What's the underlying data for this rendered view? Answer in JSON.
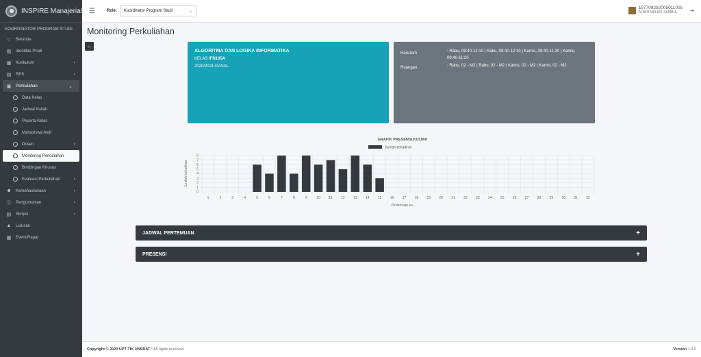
{
  "app": {
    "title": "INSPIRE Manajerial"
  },
  "sidebar": {
    "section": "KOORDINATOR PROGRAM STUDI",
    "items": [
      {
        "label": "Beranda",
        "icon": "home-icon"
      },
      {
        "label": "Identitas Prodi",
        "icon": "university-icon"
      },
      {
        "label": "Kurikulum",
        "icon": "table-icon"
      },
      {
        "label": "RPS",
        "icon": "book-icon"
      },
      {
        "label": "Perkuliahan",
        "icon": "briefcase-icon"
      }
    ],
    "sub_items": [
      {
        "label": "Data Kelas"
      },
      {
        "label": "Jadwal Kuliah"
      },
      {
        "label": "Peserta Kelas"
      },
      {
        "label": "Mahasiswa Aktif"
      },
      {
        "label": "Dosen"
      },
      {
        "label": "Monitoring Perkuliahan"
      },
      {
        "label": "Bimbingan Khusus"
      },
      {
        "label": "Evaluasi Perkuliahan"
      }
    ],
    "items_after": [
      {
        "label": "Kemahasiswaan",
        "icon": "users-icon"
      },
      {
        "label": "Pengumuman",
        "icon": "info-icon"
      },
      {
        "label": "Skripsi",
        "icon": "book-icon"
      },
      {
        "label": "Lulusan",
        "icon": "graduation-cap-icon"
      },
      {
        "label": "Event/Rapat",
        "icon": "calendar-icon"
      }
    ]
  },
  "topbar": {
    "role_label": "Role:",
    "role_value": "Koordinator Program Studi",
    "user_id": "197709292005011005",
    "user_name": "ALWIN MELKIE SAMBUL"
  },
  "page": {
    "title": "Monitoring Perkuliahan"
  },
  "course": {
    "name": "ALGORITMA DAN LOGIKA INFORMATIKA",
    "class_prefix": "KELAS ",
    "class_code": "IFN105A",
    "semester": "2020/2021 GASAL"
  },
  "schedule": {
    "day_time_label": "Hari/Jam",
    "day_time_value": ": Rabu, 09:40-12:10 | Rabu, 09:40-12:10 | Kamis, 09:40-11:20 | Kamis, 09:40-11:20",
    "room_label": "Ruangan",
    "room_value": ": Rabu, 02 - M2 | Rabu, 02 - M2 | Kamis, 02 - M2 | Kamis, 02 - M2"
  },
  "chart_data": {
    "type": "bar",
    "title": "GRAFIK PRESENSI KULIAH",
    "xlabel": "Pertemuan ke-",
    "ylabel": "Jumlah kehadiran",
    "legend": "Jumlah kehadiran",
    "ylim": [
      0,
      8
    ],
    "categories": [
      "1",
      "2",
      "3",
      "4",
      "5",
      "6",
      "7",
      "8",
      "9",
      "10",
      "11",
      "12",
      "13",
      "14",
      "15",
      "16",
      "17",
      "18",
      "19",
      "20",
      "21",
      "22",
      "23",
      "24",
      "25",
      "26",
      "27",
      "28",
      "29",
      "30",
      "31",
      "32"
    ],
    "values": [
      0,
      0,
      0,
      0,
      6,
      4,
      8,
      4,
      8,
      6,
      7,
      5,
      8,
      6,
      3,
      0,
      0,
      0,
      0,
      0,
      0,
      0,
      0,
      0,
      0,
      0,
      0,
      0,
      0,
      0,
      0,
      0
    ],
    "color": "#343a40"
  },
  "accordions": [
    {
      "label": "JADWAL PERTEMUAN"
    },
    {
      "label": "PRESENSI"
    }
  ],
  "footer": {
    "copyright": "Copyright © 2020 UPT-TIK UNSRAT",
    "rights": " * All rights reserved.",
    "version_label": "Version",
    "version": " 1.0.0"
  }
}
